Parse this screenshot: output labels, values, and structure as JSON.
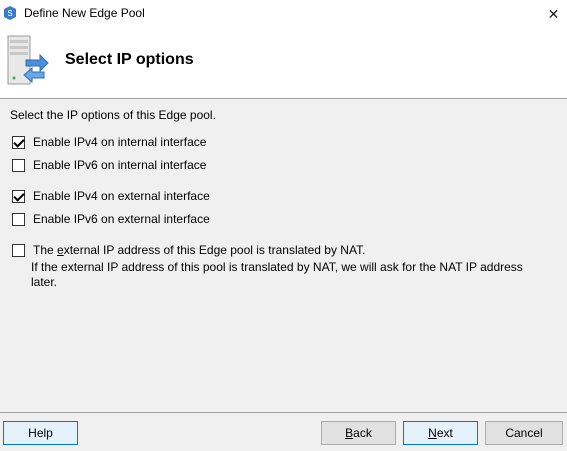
{
  "window": {
    "title": "Define New Edge Pool",
    "close_glyph": "✕"
  },
  "header": {
    "title": "Select IP options",
    "icon": "server-network-icon"
  },
  "content": {
    "intro": "Select the IP options of this Edge pool.",
    "options": [
      {
        "label": "Enable IPv4 on internal interface",
        "checked": true
      },
      {
        "label": "Enable IPv6 on internal interface",
        "checked": false
      },
      {
        "label": "Enable IPv4 on external interface",
        "checked": true
      },
      {
        "label": "Enable IPv6 on external interface",
        "checked": false
      }
    ],
    "nat": {
      "label_pre": "The ",
      "label_accel": "e",
      "label_post": "xternal IP address of this Edge pool is translated by NAT.",
      "checked": false,
      "note": "If the external IP address of this pool is translated by NAT, we will ask for the NAT IP address later."
    }
  },
  "footer": {
    "help_label": "Help",
    "back_accel": "B",
    "back_rest": "ack",
    "next_accel": "N",
    "next_rest": "ext",
    "cancel_label": "Cancel"
  },
  "colors": {
    "accent": "#0078d7",
    "dialog_bg": "#f0f0f0"
  }
}
